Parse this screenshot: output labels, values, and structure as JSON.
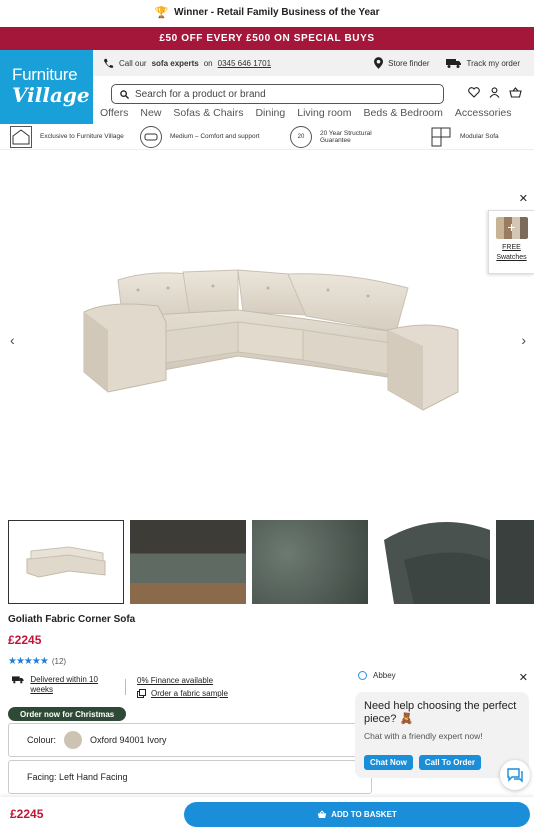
{
  "award_bar": {
    "text": "Winner - Retail Family Business of the Year",
    "icon": "trophy-icon"
  },
  "promo_bar": {
    "text": "£50 OFF EVERY £500 ON SPECIAL BUYS"
  },
  "header": {
    "logo_line1": "Furniture",
    "logo_line2": "Village",
    "call": {
      "prefix": "Call our",
      "bold": "sofa experts",
      "on": "on",
      "phone": "0345 646 1701"
    },
    "store_finder": "Store finder",
    "track_order": "Track my order",
    "search_placeholder": "Search for a product or brand",
    "nav": [
      "Offers",
      "New",
      "Sofas & Chairs",
      "Dining",
      "Living room",
      "Beds & Bedroom",
      "Accessories"
    ]
  },
  "usps": [
    {
      "label": "Exclusive to Furniture Village",
      "icon": "furniture-village-badge-icon"
    },
    {
      "label": "Medium – Comfort and support",
      "icon": "cushion-firmness-icon"
    },
    {
      "label": "20 Year Structural Guarantee",
      "icon": "guarantee-20-icon",
      "badge": "20"
    },
    {
      "label": "Modular Sofa",
      "icon": "modular-sofa-icon"
    }
  ],
  "swatches": {
    "line1": "FREE",
    "line2": "Swatches"
  },
  "product": {
    "title": "Goliath Fabric Corner Sofa",
    "price": "£2245",
    "rating_count": "(12)",
    "rating_value": 5,
    "delivery": "Delivered within 10 weeks",
    "finance": "0% Finance available",
    "sample": "Order a fabric sample",
    "christmas_badge": "Order now for Christmas",
    "colour_label": "Colour:",
    "colour_value": "Oxford 94001 Ivory",
    "facing": "Facing: Left Hand Facing"
  },
  "bottom_bar": {
    "price": "£2245",
    "button": "ADD TO BASKET"
  },
  "chat": {
    "agent": "Abbey",
    "question": "Need help choosing the perfect piece? 🧸",
    "subtitle": "Chat with a friendly expert now!",
    "btn_chat": "Chat Now",
    "btn_order": "Call To Order"
  },
  "colors": {
    "brand_blue": "#1aa0d8",
    "promo_red": "#a5173a",
    "price_red": "#c0153a",
    "button_blue": "#1a8ed8",
    "christmas_green": "#2e4a36"
  }
}
